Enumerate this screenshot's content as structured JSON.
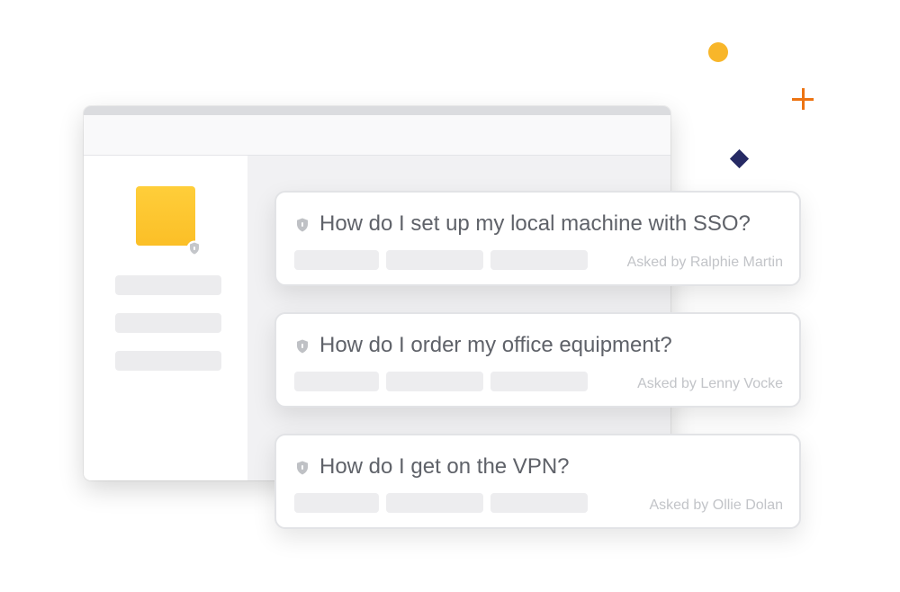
{
  "colors": {
    "accent_yellow": "#f8b62a",
    "accent_orange": "#ed7413",
    "accent_navy": "#262a64",
    "logo_yellow": "#ffc530",
    "question_text": "#5f6269",
    "meta_text": "#c2c4c8"
  },
  "decorations": [
    "circle",
    "plus",
    "diamond"
  ],
  "app_window": {
    "logo_icon": "app-logo-square",
    "logo_badge_icon": "shield-lock-icon",
    "sidebar_placeholder_count": 3
  },
  "questions": [
    {
      "icon": "shield-lock-icon",
      "text": "How do I set up my local machine with SSO?",
      "asked_by": "Asked by Ralphie Martin"
    },
    {
      "icon": "shield-lock-icon",
      "text": "How do I order my office equipment?",
      "asked_by": "Asked by Lenny Vocke"
    },
    {
      "icon": "shield-lock-icon",
      "text": "How do I get on the VPN?",
      "asked_by": "Asked by Ollie Dolan"
    }
  ]
}
